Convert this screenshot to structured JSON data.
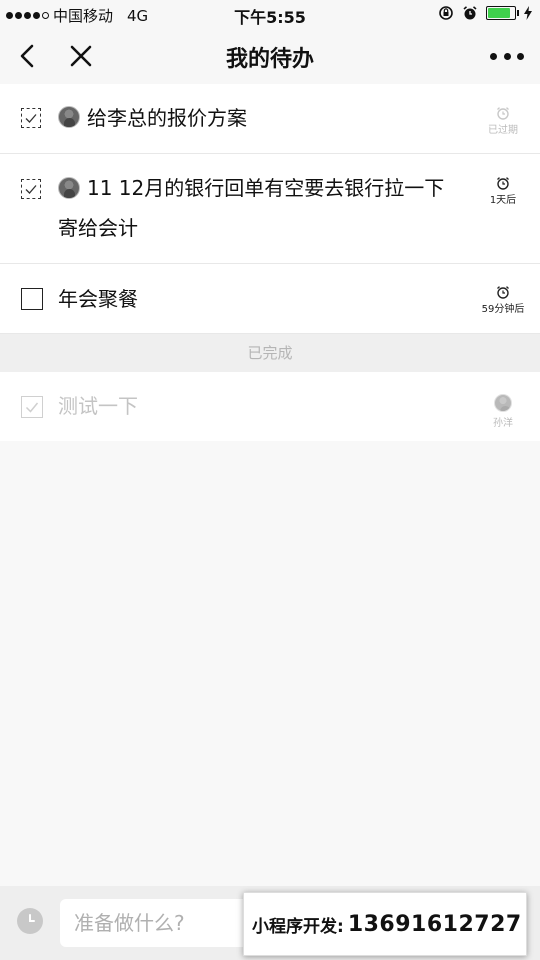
{
  "status_bar": {
    "carrier": "中国移动",
    "network": "4G",
    "time": "下午5:55",
    "battery_level": 0.85
  },
  "nav": {
    "title": "我的待办",
    "back_icon": "chevron-left-icon",
    "close_icon": "close-icon",
    "more_icon": "more-icon"
  },
  "todos": [
    {
      "text": "给李总的报价方案",
      "meta": "已过期"
    },
    {
      "text_line1": "11 12月的银行回单有空要去银行拉一下",
      "text_line2": "寄给会计",
      "meta": "1天后"
    },
    {
      "text": "年会聚餐",
      "meta": "59分钟后"
    }
  ],
  "completed_section": {
    "header": "已完成",
    "items": [
      {
        "text": "测试一下",
        "assignee": "孙洋"
      }
    ]
  },
  "input_bar": {
    "placeholder": "准备做什么?"
  },
  "promo": {
    "label": "小程序开发:",
    "phone": "13691612727"
  },
  "colors": {
    "battery": "#3fd04c",
    "completed_text": "#c4c4c4",
    "section_bg": "#efefef"
  }
}
